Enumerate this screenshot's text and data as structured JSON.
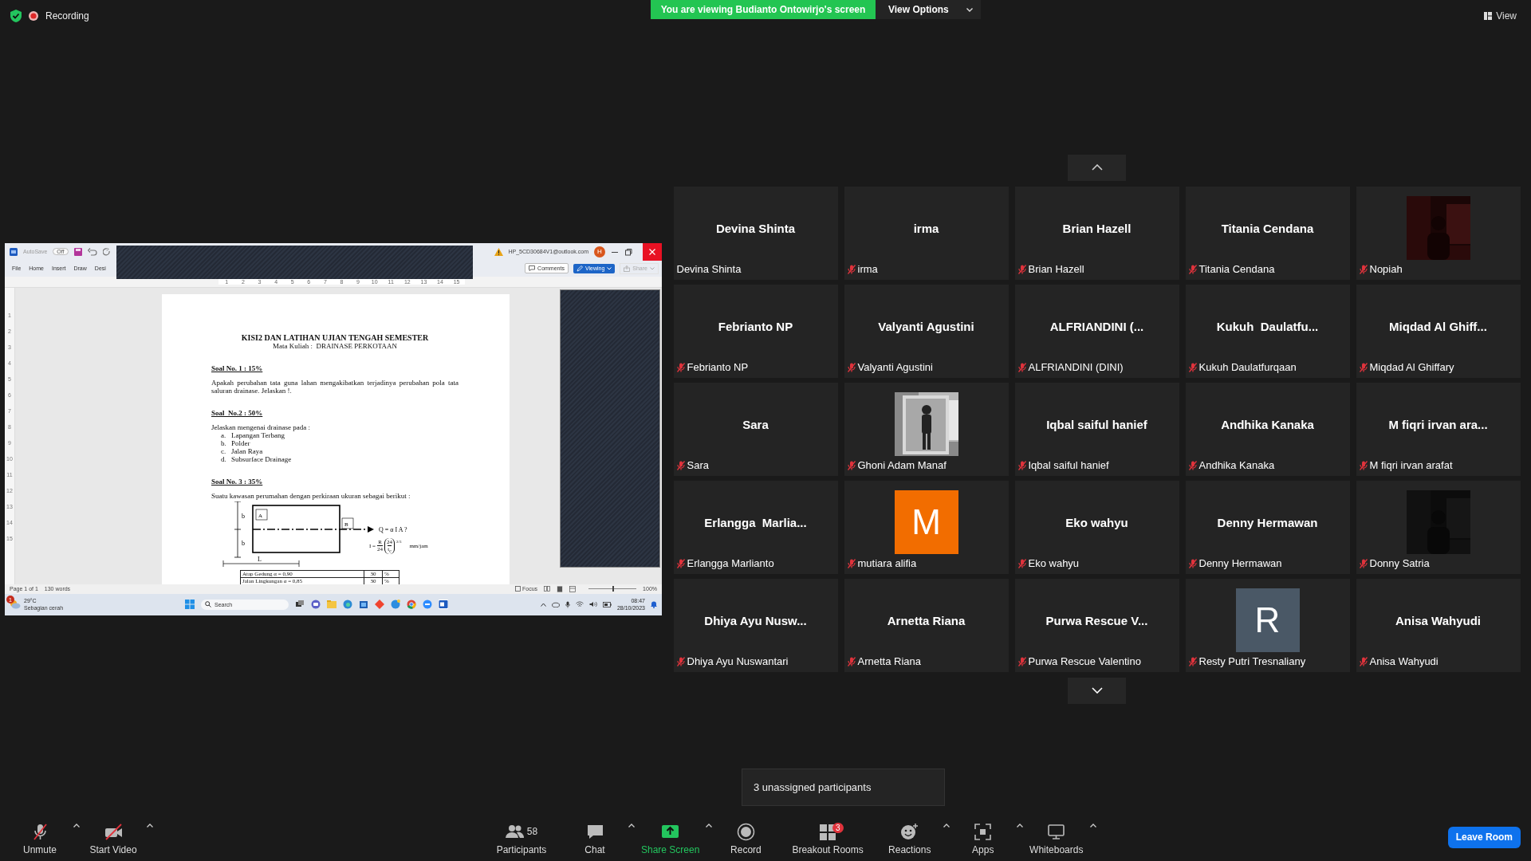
{
  "top_bar": {
    "recording": "Recording",
    "banner": "You are viewing Budianto Ontowirjo's screen",
    "view_options": "View Options",
    "view": "View"
  },
  "shared_screen": {
    "word": {
      "autosave": "AutoSave",
      "autosave_toggle": "Off",
      "account": "HP_5CD30684V1@outlook.com",
      "account_avatar": "H",
      "menu": [
        "File",
        "Home",
        "Insert",
        "Draw",
        "Desi"
      ],
      "comments": "Comments",
      "viewing": "Viewing",
      "share": {
        "label": "Share",
        "disabled": true
      },
      "ruler_h": [
        "1",
        "2",
        "3",
        "4",
        "5",
        "6",
        "7",
        "8",
        "9",
        "10",
        "11",
        "12",
        "13",
        "14",
        "15"
      ],
      "ruler_v": [
        "1",
        "2",
        "3",
        "4",
        "5",
        "6",
        "7",
        "8",
        "9",
        "10",
        "11",
        "12",
        "13",
        "14",
        "15"
      ],
      "document": {
        "title": "KISI2 DAN LATIHAN UJIAN TENGAH SEMESTER",
        "subtitle": "Mata Kuliah :  DRAINASE PERKOTAAN",
        "blocks": [
          {
            "kind": "heading",
            "text": "Soal No. 1 : 15%"
          },
          {
            "kind": "para",
            "text": "Apakah perubahan tata guna lahan mengakibatkan terjadinya perubahan pola tata saluran drainase.  Jelaskan !."
          },
          {
            "kind": "heading",
            "text": "Soal  No.2 : 50%"
          },
          {
            "kind": "para",
            "text": "Jelaskan mengenai drainase pada :"
          },
          {
            "kind": "list",
            "items": [
              {
                "marker": "a.",
                "text": "Lapangan Terbang"
              },
              {
                "marker": "b.",
                "text": "Polder"
              },
              {
                "marker": "c.",
                "text": "Jalan Raya"
              },
              {
                "marker": "d.",
                "text": "Subsurface Drainage"
              }
            ]
          },
          {
            "kind": "heading",
            "text": "Soal No. 3 : 35%"
          },
          {
            "kind": "para",
            "text": "Suatu kawasan perumahan dengan perkiraan ukuran sebagai berikut :"
          },
          {
            "kind": "diagram",
            "dim_top": "b",
            "dim_bottom": "b",
            "inlet": "A",
            "outlet": "B",
            "length": "L",
            "discharge": "Q = α I A ?",
            "formula": {
              "lhs": "I =",
              "num1": "R",
              "den1": "24",
              "num2": "24",
              "den2": "t$_{c}$",
              "exp": "2/3",
              "unit": "mm/jam"
            }
          },
          {
            "kind": "table",
            "rows": [
              [
                "Atap Gedung α = 0,90",
                "30",
                "%"
              ],
              [
                "Jalan Lingkungan α = 0,85",
                "30",
                "%"
              ]
            ]
          }
        ]
      },
      "status": {
        "page": "Page 1 of 1",
        "words": "130 words",
        "focus": "Focus",
        "zoom": "100%",
        "level": 0.5
      }
    },
    "taskbar": {
      "weather_badge": "1",
      "weather_temp": "29°C",
      "weather_text": "Sebagian cerah",
      "search": "Search",
      "time": "08:47",
      "date": "28/10/2023"
    }
  },
  "gallery": {
    "tiles": [
      {
        "kind": "name",
        "center": "Devina Shinta",
        "label": "Devina Shinta",
        "muted": false
      },
      {
        "kind": "name",
        "center": "irma",
        "label": "irma",
        "muted": true
      },
      {
        "kind": "name",
        "center": "Brian Hazell",
        "label": "Brian Hazell",
        "muted": true
      },
      {
        "kind": "name",
        "center": "Titania Cendana",
        "label": "Titania Cendana",
        "muted": true
      },
      {
        "kind": "picture",
        "label": "Nopiah",
        "muted": true
      },
      {
        "kind": "name",
        "center": "Febrianto NP",
        "label": "Febrianto NP",
        "muted": true
      },
      {
        "kind": "name",
        "center": "Valyanti Agustini",
        "label": "Valyanti Agustini",
        "muted": true
      },
      {
        "kind": "name",
        "center": "ALFRIANDINI (...",
        "label": "ALFRIANDINI (DINI)",
        "muted": true
      },
      {
        "kind": "name",
        "center": "Kukuh  Daulatfu...",
        "label": "Kukuh Daulatfurqaan",
        "muted": true
      },
      {
        "kind": "name",
        "center": "Miqdad Al Ghiff...",
        "label": "Miqdad Al Ghiffary",
        "muted": true
      },
      {
        "kind": "name",
        "center": "Sara",
        "label": "Sara",
        "muted": true
      },
      {
        "kind": "picture",
        "label": "Ghoni Adam Manaf",
        "muted": true
      },
      {
        "kind": "name",
        "center": "Iqbal saiful hanief",
        "label": "Iqbal saiful hanief",
        "muted": true
      },
      {
        "kind": "name",
        "center": "Andhika Kanaka",
        "label": "Andhika Kanaka",
        "muted": true
      },
      {
        "kind": "name",
        "center": "M fiqri irvan ara...",
        "label": "M fiqri irvan arafat",
        "muted": true
      },
      {
        "kind": "name",
        "center": "Erlangga  Marlia...",
        "label": "Erlangga Marlianto",
        "muted": true
      },
      {
        "kind": "letter",
        "letter": "M",
        "color": "#f26d00",
        "label": "mutiara alifia",
        "muted": true
      },
      {
        "kind": "name",
        "center": "Eko wahyu",
        "label": "Eko wahyu",
        "muted": true
      },
      {
        "kind": "name",
        "center": "Denny Hermawan",
        "label": "Denny Hermawan",
        "muted": true
      },
      {
        "kind": "picture",
        "label": "Donny Satria",
        "muted": true
      },
      {
        "kind": "name",
        "center": "Dhiya Ayu Nusw...",
        "label": "Dhiya Ayu Nuswantari",
        "muted": true
      },
      {
        "kind": "name",
        "center": "Arnetta Riana",
        "label": "Arnetta Riana",
        "muted": true
      },
      {
        "kind": "name",
        "center": "Purwa Rescue V...",
        "label": "Purwa Rescue Valentino",
        "muted": true
      },
      {
        "kind": "letter",
        "letter": "R",
        "color": "#4a5866",
        "label": "Resty Putri Tresnaliany",
        "muted": true
      },
      {
        "kind": "name",
        "center": "Anisa Wahyudi",
        "label": "Anisa Wahyudi",
        "muted": true
      }
    ]
  },
  "tooltip": "3 unassigned participants",
  "toolbar": {
    "left_items": [
      {
        "kind": "mic-muted",
        "label": "Unmute",
        "caret": true
      },
      {
        "kind": "video-off",
        "label": "Start Video",
        "caret": true
      }
    ],
    "center_items": [
      {
        "kind": "participants",
        "label": "Participants",
        "count": "58",
        "caret": false
      },
      {
        "kind": "chat",
        "label": "Chat",
        "caret": true
      },
      {
        "kind": "share",
        "label": "Share Screen",
        "caret": true
      },
      {
        "kind": "record",
        "label": "Record",
        "caret": false
      },
      {
        "kind": "breakout",
        "label": "Breakout Rooms",
        "badge": "3",
        "caret": false
      },
      {
        "kind": "reactions",
        "label": "Reactions",
        "caret": true
      },
      {
        "kind": "apps",
        "label": "Apps",
        "caret": true
      },
      {
        "kind": "whiteboards",
        "label": "Whiteboards",
        "caret": true
      }
    ],
    "leave": "Leave Room"
  }
}
